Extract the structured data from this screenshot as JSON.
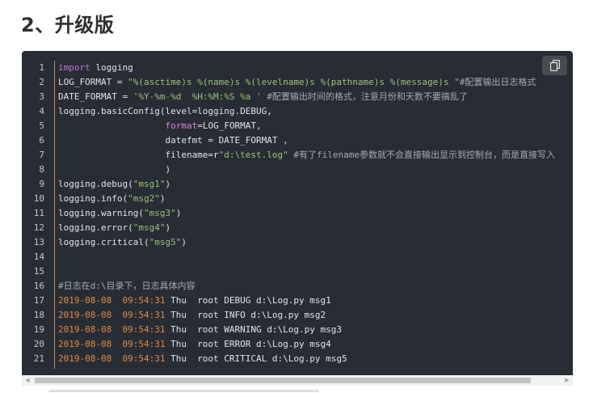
{
  "heading": "2、升级版",
  "code_block": {
    "line_numbers": [
      "1",
      "2",
      "3",
      "4",
      "5",
      "6",
      "7",
      "8",
      "9",
      "10",
      "11",
      "12",
      "13",
      "14",
      "15",
      "16",
      "17",
      "18",
      "19",
      "20",
      "21"
    ],
    "lines": [
      [
        {
          "t": "import",
          "c": "kw"
        },
        {
          "t": " logging",
          "c": ""
        }
      ],
      [
        {
          "t": "LOG_FORMAT = ",
          "c": ""
        },
        {
          "t": "\"%(asctime)s %(name)s %(levelname)s %(pathname)s %(message)s \"",
          "c": "str"
        },
        {
          "t": "#配置输出日志格式",
          "c": "cm"
        }
      ],
      [
        {
          "t": "DATE_FORMAT = ",
          "c": ""
        },
        {
          "t": "'%Y-%m-%d  %H:%M:%S %a '",
          "c": "str"
        },
        {
          "t": " #配置输出时间的格式，注意月份和天数不要搞乱了",
          "c": "cm"
        }
      ],
      [
        {
          "t": "logging.basicConfig(level=logging.DEBUG,",
          "c": ""
        }
      ],
      [
        {
          "t": "                    ",
          "c": ""
        },
        {
          "t": "format",
          "c": "param"
        },
        {
          "t": "=LOG_FORMAT,",
          "c": ""
        }
      ],
      [
        {
          "t": "                    datefmt = DATE_FORMAT ,",
          "c": ""
        }
      ],
      [
        {
          "t": "                    filename=r",
          "c": ""
        },
        {
          "t": "\"d:\\test.log\"",
          "c": "str"
        },
        {
          "t": " #有了filename参数就不会直接输出显示到控制台，而是直接写入",
          "c": "cm"
        }
      ],
      [
        {
          "t": "                    )",
          "c": ""
        }
      ],
      [
        {
          "t": "logging.debug(",
          "c": ""
        },
        {
          "t": "\"msg1\"",
          "c": "str"
        },
        {
          "t": ")",
          "c": ""
        }
      ],
      [
        {
          "t": "logging.info(",
          "c": ""
        },
        {
          "t": "\"msg2\"",
          "c": "str"
        },
        {
          "t": ")",
          "c": ""
        }
      ],
      [
        {
          "t": "logging.warning(",
          "c": ""
        },
        {
          "t": "\"msg3\"",
          "c": "str"
        },
        {
          "t": ")",
          "c": ""
        }
      ],
      [
        {
          "t": "logging.error(",
          "c": ""
        },
        {
          "t": "\"msg4\"",
          "c": "str"
        },
        {
          "t": ")",
          "c": ""
        }
      ],
      [
        {
          "t": "logging.critical(",
          "c": ""
        },
        {
          "t": "\"msg5\"",
          "c": "str"
        },
        {
          "t": ")",
          "c": ""
        }
      ],
      [],
      [],
      [
        {
          "t": "#日志在d:\\目录下，日志具体内容",
          "c": "cm"
        }
      ],
      [
        {
          "t": "2019-08-08  09:54:31",
          "c": "num"
        },
        {
          "t": " Thu  root DEBUG d:\\Log.py msg1",
          "c": ""
        }
      ],
      [
        {
          "t": "2019-08-08  09:54:31",
          "c": "num"
        },
        {
          "t": " Thu  root INFO d:\\Log.py msg2",
          "c": ""
        }
      ],
      [
        {
          "t": "2019-08-08  09:54:31",
          "c": "num"
        },
        {
          "t": " Thu  root WARNING d:\\Log.py msg3",
          "c": ""
        }
      ],
      [
        {
          "t": "2019-08-08  09:54:31",
          "c": "num"
        },
        {
          "t": " Thu  root ERROR d:\\Log.py msg4",
          "c": ""
        }
      ],
      [
        {
          "t": "2019-08-08  09:54:31",
          "c": "num"
        },
        {
          "t": " Thu  root CRITICAL d:\\Log.py msg5",
          "c": ""
        }
      ]
    ]
  },
  "copy_button": {
    "icon": "copy-icon"
  },
  "scrollbar": {
    "left_arrow": "◀",
    "right_arrow": "▶"
  }
}
